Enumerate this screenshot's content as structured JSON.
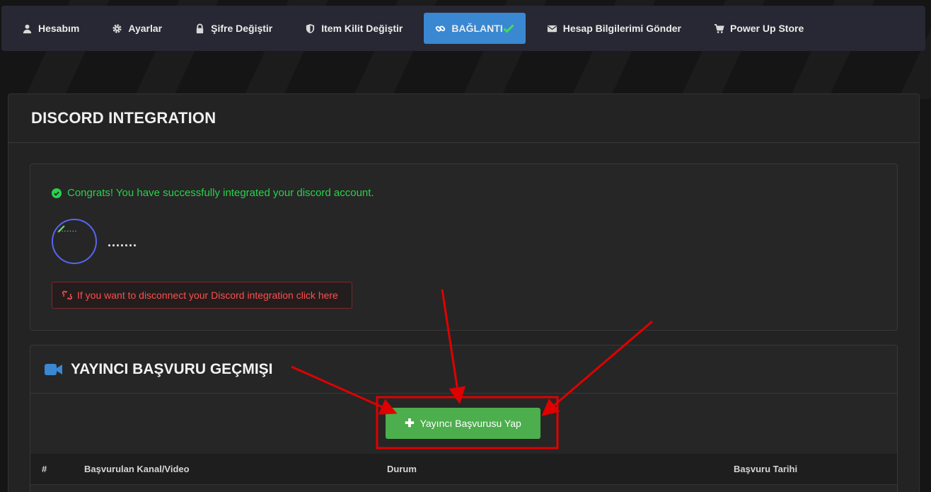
{
  "nav": {
    "items": [
      {
        "label": "Hesabım",
        "icon": "user-icon"
      },
      {
        "label": "Ayarlar",
        "icon": "gear-icon"
      },
      {
        "label": "Şifre Değiştir",
        "icon": "lock-icon"
      },
      {
        "label": "Item Kilit Değiştir",
        "icon": "shield-icon"
      },
      {
        "label": "BAĞLANTI",
        "icon": "link-icon",
        "active": true,
        "badge_icon": "check-icon"
      },
      {
        "label": "Hesap Bilgilerimi Gönder",
        "icon": "envelope-icon"
      },
      {
        "label": "Power Up Store",
        "icon": "cart-icon"
      }
    ]
  },
  "panel": {
    "title": "DISCORD INTEGRATION"
  },
  "integration": {
    "success_message": "Congrats! You have successfully integrated your discord account.",
    "avatar_text": ".......",
    "username": ".......",
    "disconnect_text": "If you want to disconnect your Discord integration click here"
  },
  "streamer": {
    "title": "YAYINCI BAŞVURU GEÇMIŞI",
    "icon": "video-camera-icon",
    "apply_button": "Yayıncı Başvurusu Yap",
    "table_headers": [
      "#",
      "Başvurulan Kanal/Video",
      "Durum",
      "Başvuru Tarihi"
    ]
  },
  "colors": {
    "accent": "#3a87d2",
    "success": "#27d24a",
    "danger": "#ff4d4d",
    "button_green": "#4cae4c",
    "annotation_red": "#e00000",
    "discord": "#5865f2"
  }
}
